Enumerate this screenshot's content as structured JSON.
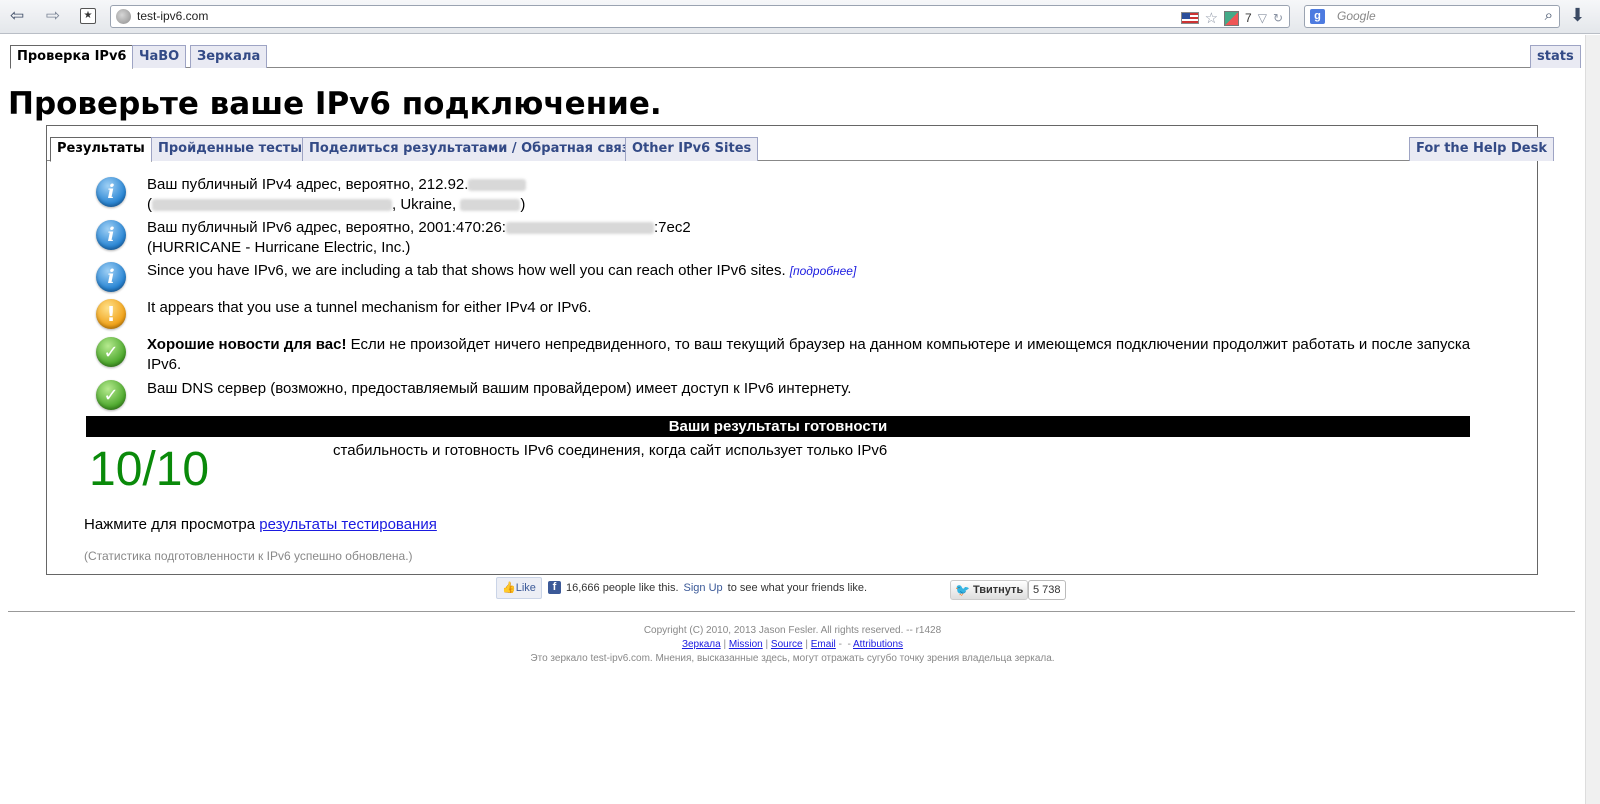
{
  "browser": {
    "url": "test-ipv6.com",
    "addon_count": "7",
    "search_placeholder": "Google"
  },
  "top_tabs": [
    "Проверка IPv6",
    "ЧаВО",
    "Зеркала",
    "stats"
  ],
  "page_title": "Проверьте ваше IPv6 подключение.",
  "inner_tabs": [
    "Результаты",
    "Пройденные тесты",
    "Поделиться результатами / Обратная связь",
    "Other IPv6 Sites",
    "For the Help Desk"
  ],
  "messages": {
    "ipv4_line1": "Ваш публичный IPv4 адрес, вероятно, 212.92.",
    "ipv4_line2_prefix": "(",
    "ipv4_line2_mid": ", Ukraine, ",
    "ipv4_line2_suffix": ")",
    "ipv6_line1_prefix": "Ваш публичный IPv6 адрес, вероятно, 2001:470:26:",
    "ipv6_line1_suffix": ":7ec2",
    "ipv6_line2": "(HURRICANE - Hurricane Electric, Inc.)",
    "tab_note": "Since you have IPv6, we are including a tab that shows how well you can reach other IPv6 sites.",
    "tab_note_link": "[подробнее]",
    "tunnel": "It appears that you use a tunnel mechanism for either IPv4 or IPv6.",
    "good_news_bold": "Хорошие новости для вас!",
    "good_news_text": " Если не произойдет ничего непредвиденного, то ваш текущий браузер на данном компьютере и имеющемся подключении продолжит работать и после запуска IPv6.",
    "dns": "Ваш DNS сервер (возможно, предоставляемый вашим провайдером) имеет доступ к IPv6 интернету."
  },
  "readiness": {
    "header": "Ваши результаты готовности",
    "score": "10/10",
    "description": "стабильность и готовность IPv6 соединения, когда сайт использует только IPv6"
  },
  "view_results": {
    "prefix": "Нажмите для просмотра ",
    "link": "результаты тестирования"
  },
  "status_note": "(Статистика подготовленности к IPv6 успешно обновлена.)",
  "social": {
    "like_label": "Like",
    "fb_count_text": "16,666 people like this.",
    "fb_signup": "Sign Up",
    "fb_suffix": "to see what your friends like.",
    "tweet_label": "Твитнуть",
    "tweet_count": "5 738"
  },
  "footer": {
    "copyright": "Copyright (C) 2010, 2013 Jason Fesler. All rights reserved. -- r1428",
    "links": [
      "Зеркала",
      "Mission",
      "Source",
      "Email",
      "Attributions"
    ],
    "mirror_note": "Это зеркало test-ipv6.com. Мнения, высказанные здесь, могут отражать сугубо точку зрения владельца зеркала."
  },
  "colors": {
    "score_green": "#0a8a0a",
    "tab_text": "#334a86",
    "link_blue": "#1a1ae0"
  },
  "icons": [
    "info-icon",
    "info-icon",
    "info-icon",
    "warning-icon",
    "ok-icon",
    "ok-icon"
  ]
}
